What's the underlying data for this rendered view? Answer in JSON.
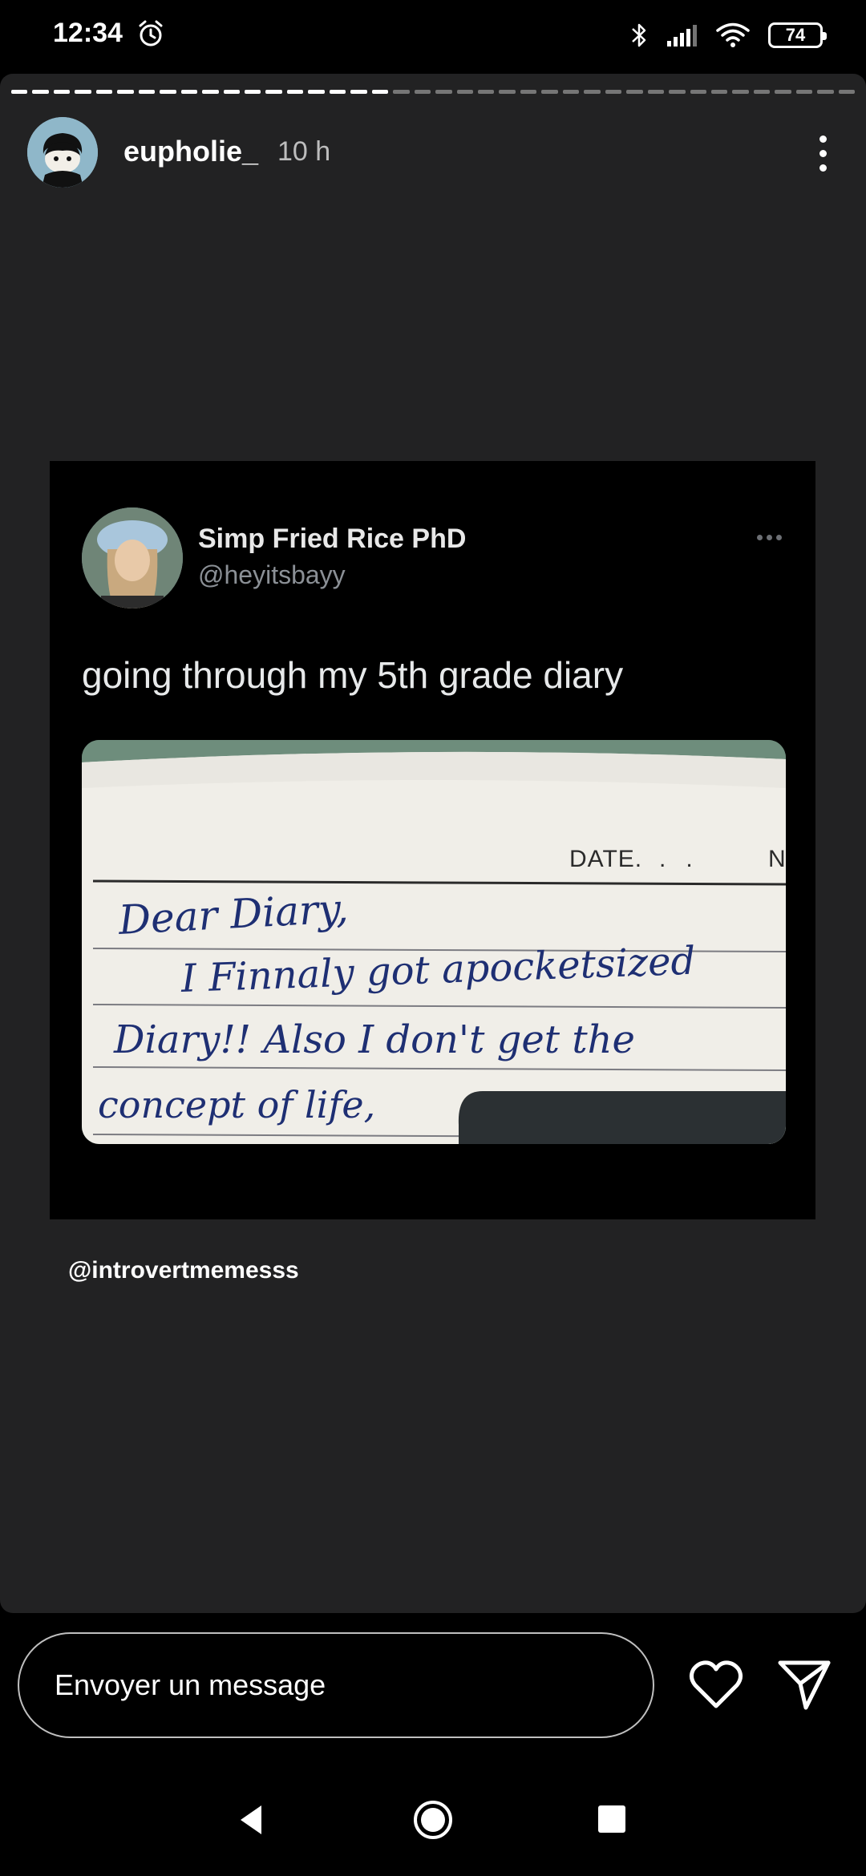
{
  "status_bar": {
    "time": "12:34",
    "battery": "74"
  },
  "story": {
    "username": "eupholie_",
    "time_ago": "10 h",
    "progress": {
      "segments": 40,
      "completed": 18
    },
    "mention": "@introvertmemesss"
  },
  "tweet": {
    "name": "Simp Fried Rice PhD",
    "handle": "@heyitsbayy",
    "text": "going through my 5th grade diary",
    "image": {
      "date_label": "DATE.",
      "corner_letter": "N",
      "lines": [
        "Dear Diary,",
        "I Finnaly got apocketsized",
        "Diary!! Also I don't get the",
        "concept of life,"
      ]
    }
  },
  "composer": {
    "placeholder": "Envoyer un message"
  },
  "icons": {
    "alarm": "alarm-clock-icon",
    "bluetooth": "bluetooth-icon",
    "signal": "signal-icon",
    "wifi": "wifi-icon",
    "battery": "battery-icon",
    "more": "more-vertical-icon",
    "heart": "heart-icon",
    "send": "send-icon",
    "back": "back-icon",
    "home": "home-icon",
    "recent": "recent-apps-icon"
  }
}
